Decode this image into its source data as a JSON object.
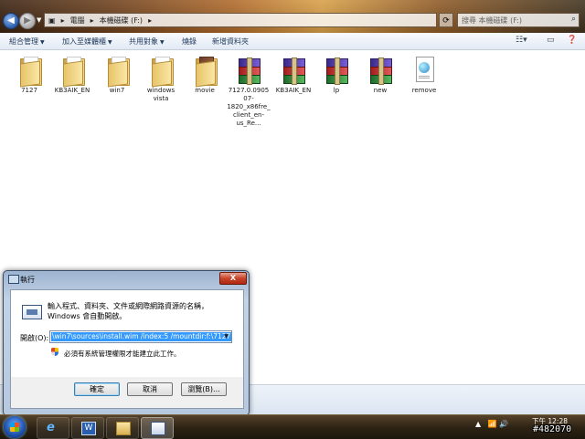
{
  "explorer": {
    "breadcrumb": [
      "電腦",
      "本機磁碟 (F:)"
    ],
    "search_placeholder": "搜尋 本機磁碟 (F:)",
    "toolbar": {
      "organize": "組合管理",
      "include_library": "加入至媒體櫃",
      "share_with": "共用對象",
      "burn": "燒錄",
      "new_folder": "新增資料夾"
    },
    "files": [
      {
        "name": "7127",
        "type": "folder"
      },
      {
        "name": "KB3AIK_EN",
        "type": "folder"
      },
      {
        "name": "win7",
        "type": "folder"
      },
      {
        "name": "windows vista",
        "type": "folder"
      },
      {
        "name": "movie",
        "type": "folder-movie"
      },
      {
        "name": "7127.0.090507-1820_x86fre_client_en-us_Re...",
        "type": "archive"
      },
      {
        "name": "KB3AIK_EN",
        "type": "archive"
      },
      {
        "name": "lp",
        "type": "archive"
      },
      {
        "name": "new",
        "type": "archive"
      },
      {
        "name": "remove",
        "type": "document"
      }
    ]
  },
  "run_dialog": {
    "title": "執行",
    "description": "輸入程式、資料夾、文件或網際網路資源的名稱，Windows 會自動開啟。",
    "open_label": "開啟(O):",
    "command_value": "\\win7\\sources\\install.wim /index:5 /mountdir:f:\\7127",
    "admin_note": "必須有系統管理權限才能建立此工作。",
    "ok_label": "確定",
    "cancel_label": "取消",
    "browse_label": "瀏覽(B)...",
    "close_symbol": "X"
  },
  "taskbar": {
    "clock_time": "下午 12:28",
    "watermark": "#482070",
    "buttons": [
      "internet-explorer",
      "word",
      "file-explorer",
      "run"
    ]
  },
  "colors": {
    "accent_blue": "#3399ff",
    "close_red": "#c8432a"
  }
}
